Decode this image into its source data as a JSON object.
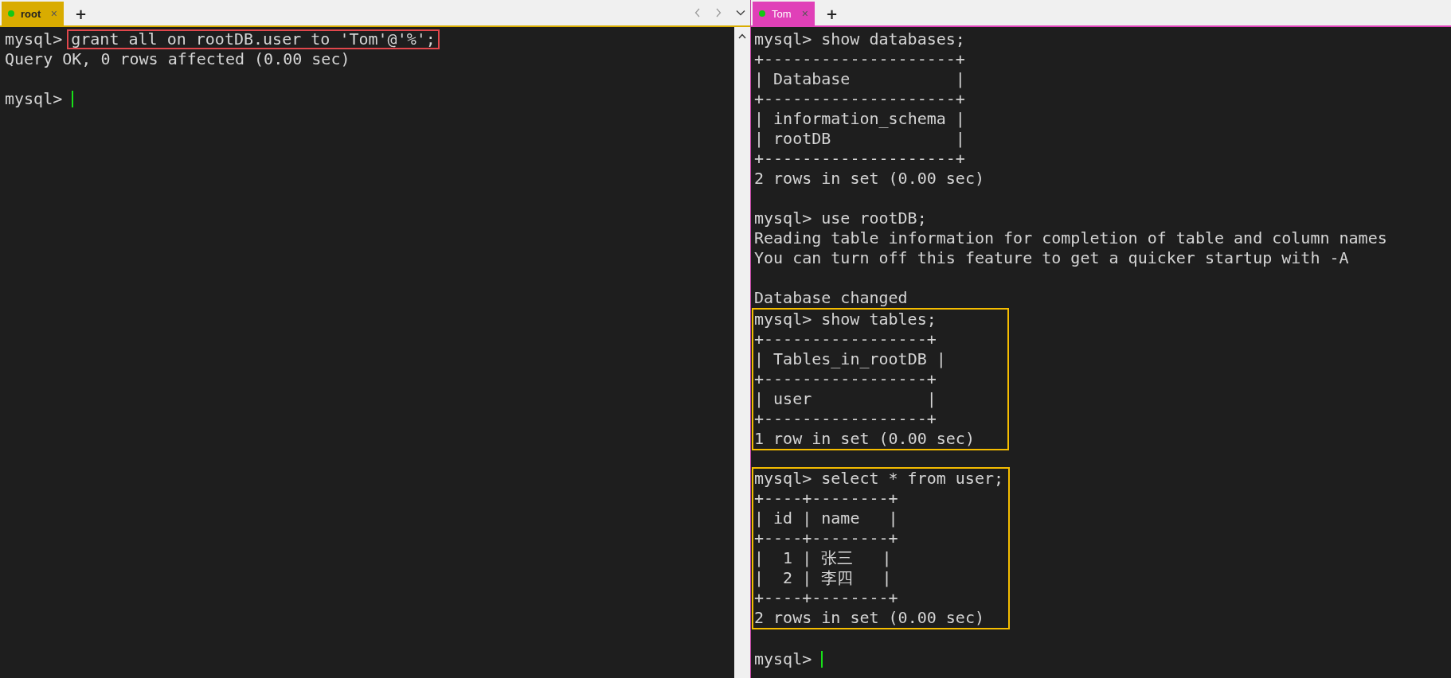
{
  "panes": [
    {
      "tab": {
        "label": "root",
        "close": "×",
        "color": "#d9ac00",
        "selected": true
      },
      "new_tab": "+",
      "nav": true,
      "blocks": [
        {
          "highlighted": false,
          "gap_above": false,
          "lines": [
            {
              "prompt": "mysql>",
              "command": "grant all on rootDB.user to 'Tom'@'%';",
              "boxed": true
            },
            {
              "text": "Query OK, 0 rows affected (0.00 sec)"
            },
            {
              "prompt": "mysql>",
              "cursor": true,
              "gap_above": true
            }
          ]
        }
      ]
    },
    {
      "tab": {
        "label": "Tom",
        "close": "×",
        "color": "#e040b8",
        "selected": true
      },
      "new_tab": "+",
      "nav": false,
      "blocks": [
        {
          "highlighted": false,
          "gap_above": false,
          "lines": [
            {
              "prompt": "mysql>",
              "command": "show databases;"
            },
            {
              "text": "+--------------------+"
            },
            {
              "text": "| Database           |"
            },
            {
              "text": "+--------------------+"
            },
            {
              "text": "| information_schema |"
            },
            {
              "text": "| rootDB             |"
            },
            {
              "text": "+--------------------+"
            },
            {
              "text": "2 rows in set (0.00 sec)"
            },
            {
              "prompt": "mysql>",
              "command": "use rootDB;",
              "gap_above": true
            },
            {
              "text": "Reading table information for completion of table and column names"
            },
            {
              "text": "You can turn off this feature to get a quicker startup with -A"
            },
            {
              "text": "Database changed",
              "gap_above": true
            }
          ]
        },
        {
          "highlighted": true,
          "gap_above": false,
          "lines": [
            {
              "prompt": "mysql>",
              "command": "show tables;"
            },
            {
              "text": "+-----------------+"
            },
            {
              "text": "| Tables_in_rootDB |"
            },
            {
              "text": "+-----------------+"
            },
            {
              "text": "| user            |"
            },
            {
              "text": "+-----------------+"
            },
            {
              "text": "1 row in set (0.00 sec)"
            }
          ]
        },
        {
          "highlighted": true,
          "gap_above": true,
          "lines": [
            {
              "prompt": "mysql>",
              "command": "select * from user;"
            },
            {
              "text": "+----+--------+"
            },
            {
              "text": "| id | name   |"
            },
            {
              "text": "+----+--------+"
            },
            {
              "text": "|  1 | 张三   |"
            },
            {
              "text": "|  2 | 李四   |"
            },
            {
              "text": "+----+--------+"
            },
            {
              "text": "2 rows in set (0.00 sec)"
            }
          ]
        },
        {
          "highlighted": false,
          "gap_above": true,
          "lines": [
            {
              "prompt": "mysql>",
              "cursor": true
            }
          ]
        }
      ]
    }
  ]
}
